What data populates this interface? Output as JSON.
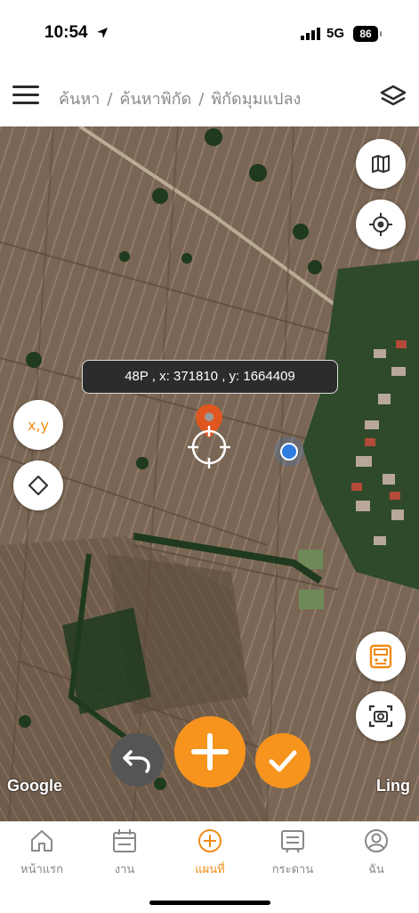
{
  "status_bar": {
    "time": "10:54",
    "network": "5G",
    "battery": "86"
  },
  "header": {
    "breadcrumb": [
      "ค้นหา",
      "ค้นหาพิกัด",
      "พิกัดมุมแปลง"
    ],
    "separator": "/"
  },
  "map": {
    "coordinate_readout": "48P , x: 371810 , y: 1664409",
    "xy_button": "x,y",
    "attribution_left": "Google",
    "attribution_right": "Ling"
  },
  "icons": {
    "menu": "menu-icon",
    "layers": "layers-icon",
    "map_type": "map-icon",
    "locate": "gps-locate-icon",
    "diamond": "diamond-icon",
    "calculator": "calculator-icon",
    "screenshot": "screenshot-icon",
    "undo": "undo-icon",
    "add": "plus-icon",
    "confirm": "check-icon"
  },
  "tabs": [
    {
      "label": "หน้าแรก",
      "icon": "home-icon"
    },
    {
      "label": "งาน",
      "icon": "calendar-icon"
    },
    {
      "label": "แผนที่",
      "icon": "plus-circle-icon",
      "active": true
    },
    {
      "label": "กระดาน",
      "icon": "board-icon"
    },
    {
      "label": "ฉัน",
      "icon": "user-icon"
    }
  ],
  "colors": {
    "accent": "#f7941d",
    "pin": "#e0561f",
    "user_dot": "#2f7de1"
  }
}
